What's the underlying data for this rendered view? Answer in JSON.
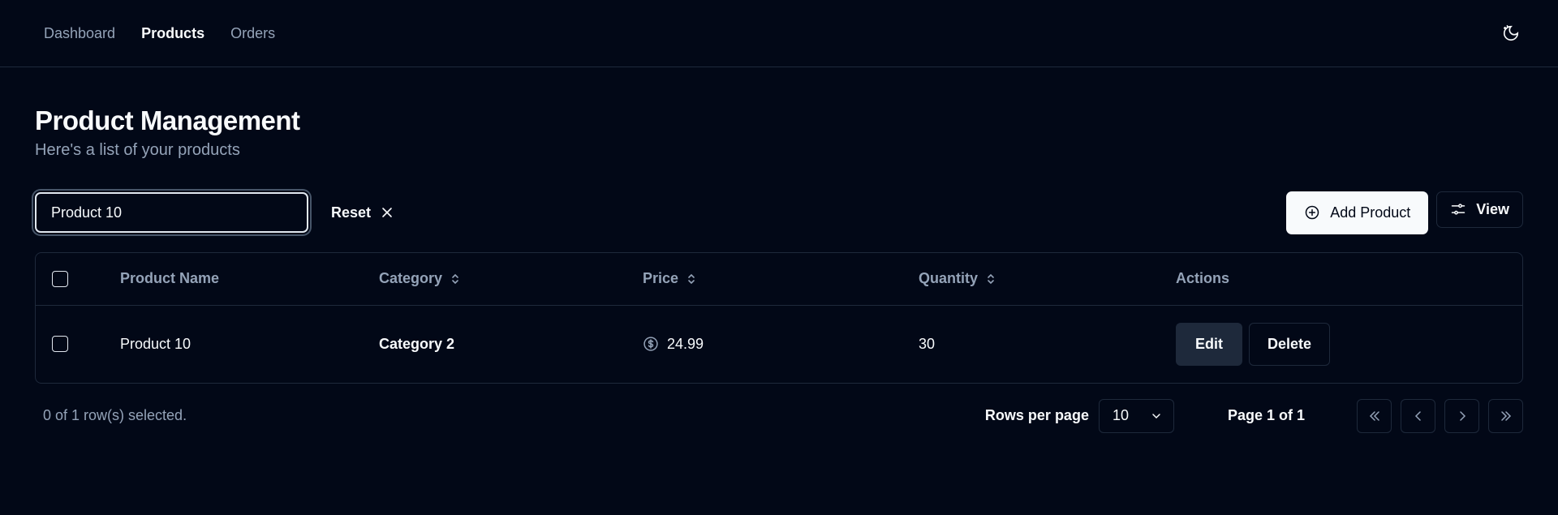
{
  "nav": {
    "links": [
      "Dashboard",
      "Products",
      "Orders"
    ],
    "active": "Products",
    "theme_icon": "moon-sun-icon"
  },
  "header": {
    "title": "Product Management",
    "subtitle": "Here's a list of your products"
  },
  "toolbar": {
    "filter_value": "Product 10",
    "reset_label": "Reset",
    "add_label": "Add Product",
    "view_label": "View"
  },
  "table": {
    "columns": [
      "Product Name",
      "Category",
      "Price",
      "Quantity",
      "Actions"
    ],
    "rows": [
      {
        "name": "Product 10",
        "category": "Category 2",
        "price": "24.99",
        "quantity": "30",
        "edit": "Edit",
        "delete": "Delete"
      }
    ]
  },
  "footer": {
    "selected_text": "0 of 1 row(s) selected.",
    "rows_per_page_label": "Rows per page",
    "rows_per_page_value": "10",
    "page_info": "Page 1 of 1"
  },
  "colors": {
    "background": "#020817",
    "border": "#1e293b",
    "muted": "#94a3b8",
    "foreground": "#f8fafc"
  }
}
